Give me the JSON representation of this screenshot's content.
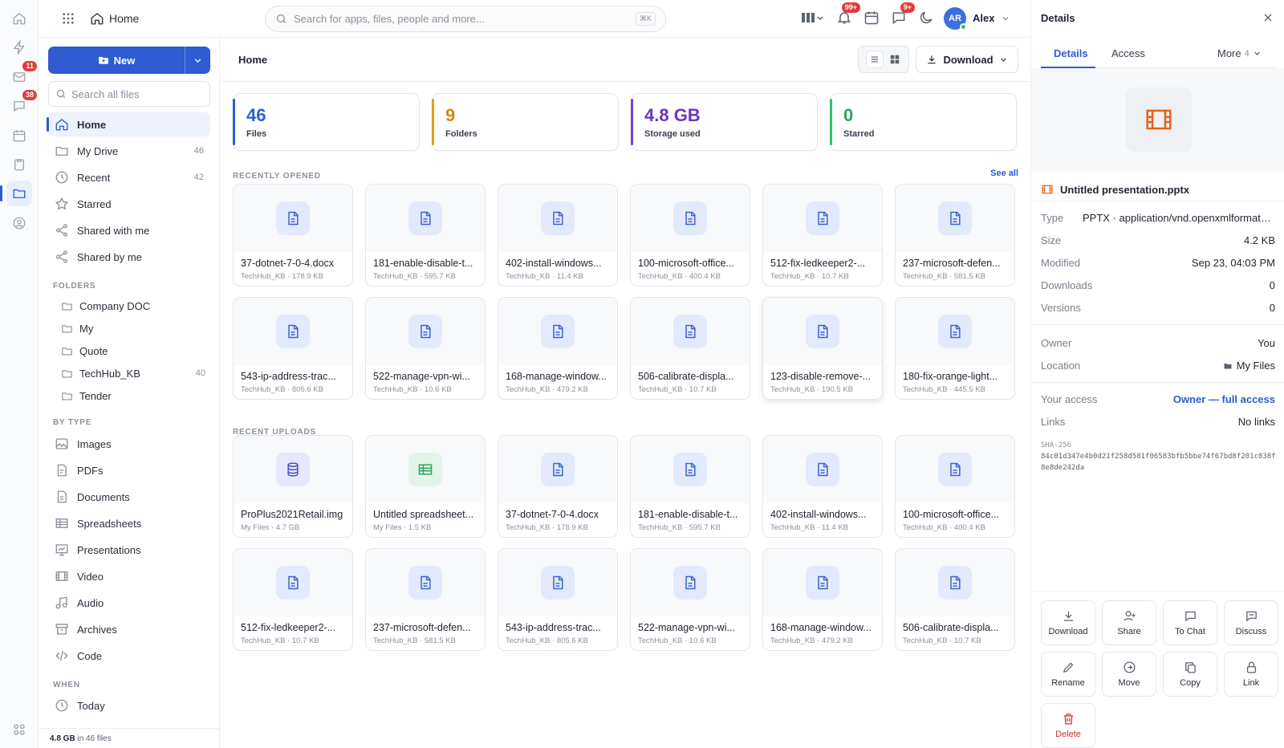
{
  "rail": {
    "mail_badge": "11",
    "chat_badge": "38"
  },
  "topbar": {
    "crumb": "Home",
    "search_placeholder": "Search for apps, files, people and more...",
    "search_kbd": "⌘K",
    "notif_badge": "99+",
    "alert_badge": "9+",
    "avatar_initials": "AR",
    "user_name": "Alex"
  },
  "sidebar": {
    "new_label": "New",
    "search_placeholder": "Search all files",
    "nav": [
      {
        "label": "Home",
        "count": ""
      },
      {
        "label": "My Drive",
        "count": "46"
      },
      {
        "label": "Recent",
        "count": "42"
      },
      {
        "label": "Starred",
        "count": ""
      },
      {
        "label": "Shared with me",
        "count": ""
      },
      {
        "label": "Shared by me",
        "count": ""
      }
    ],
    "folders_title": "FOLDERS",
    "folders": [
      {
        "label": "Company DOC",
        "count": ""
      },
      {
        "label": "My",
        "count": ""
      },
      {
        "label": "Quote",
        "count": ""
      },
      {
        "label": "TechHub_KB",
        "count": "40"
      },
      {
        "label": "Tender",
        "count": ""
      }
    ],
    "bytype_title": "BY TYPE",
    "types": [
      "Images",
      "PDFs",
      "Documents",
      "Spreadsheets",
      "Presentations",
      "Video",
      "Audio",
      "Archives",
      "Code"
    ],
    "when_title": "WHEN",
    "when": [
      "Today"
    ],
    "footer_size": "4.8 GB",
    "footer_rest": " in 46 files"
  },
  "main": {
    "title": "Home",
    "download_label": "Download",
    "stats": [
      {
        "value": "46",
        "label": "Files"
      },
      {
        "value": "9",
        "label": "Folders"
      },
      {
        "value": "4.8 GB",
        "label": "Storage used"
      },
      {
        "value": "0",
        "label": "Starred"
      }
    ],
    "recent_title": "RECENTLY OPENED",
    "see_all": "See all",
    "recent": [
      {
        "name": "37-dotnet-7-0-4.docx",
        "meta": "TechHub_KB · 178.9 KB"
      },
      {
        "name": "181-enable-disable-t...",
        "meta": "TechHub_KB · 595.7 KB"
      },
      {
        "name": "402-install-windows...",
        "meta": "TechHub_KB · 11.4 KB"
      },
      {
        "name": "100-microsoft-office...",
        "meta": "TechHub_KB · 400.4 KB"
      },
      {
        "name": "512-fix-ledkeeper2-...",
        "meta": "TechHub_KB · 10.7 KB"
      },
      {
        "name": "237-microsoft-defen...",
        "meta": "TechHub_KB · 581.5 KB"
      },
      {
        "name": "543-ip-address-trac...",
        "meta": "TechHub_KB · 805.6 KB"
      },
      {
        "name": "522-manage-vpn-wi...",
        "meta": "TechHub_KB · 10.6 KB"
      },
      {
        "name": "168-manage-window...",
        "meta": "TechHub_KB · 479.2 KB"
      },
      {
        "name": "506-calibrate-displa...",
        "meta": "TechHub_KB · 10.7 KB"
      },
      {
        "name": "123-disable-remove-...",
        "meta": "TechHub_KB · 190.5 KB"
      },
      {
        "name": "180-fix-orange-light...",
        "meta": "TechHub_KB · 445.5 KB"
      }
    ],
    "uploads_title": "RECENT UPLOADS",
    "uploads": [
      {
        "name": "ProPlus2021Retail.img",
        "meta": "My Files · 4.7 GB",
        "kind": "db"
      },
      {
        "name": "Untitled spreadsheet...",
        "meta": "My Files · 1.5 KB",
        "kind": "sheet"
      },
      {
        "name": "37-dotnet-7-0-4.docx",
        "meta": "TechHub_KB · 178.9 KB",
        "kind": "doc"
      },
      {
        "name": "181-enable-disable-t...",
        "meta": "TechHub_KB · 595.7 KB",
        "kind": "doc"
      },
      {
        "name": "402-install-windows...",
        "meta": "TechHub_KB · 11.4 KB",
        "kind": "doc"
      },
      {
        "name": "100-microsoft-office...",
        "meta": "TechHub_KB · 400.4 KB",
        "kind": "doc"
      },
      {
        "name": "512-fix-ledkeeper2-...",
        "meta": "TechHub_KB · 10.7 KB",
        "kind": "doc"
      },
      {
        "name": "237-microsoft-defen...",
        "meta": "TechHub_KB · 581.5 KB",
        "kind": "doc"
      },
      {
        "name": "543-ip-address-trac...",
        "meta": "TechHub_KB · 805.6 KB",
        "kind": "doc"
      },
      {
        "name": "522-manage-vpn-wi...",
        "meta": "TechHub_KB · 10.6 KB",
        "kind": "doc"
      },
      {
        "name": "168-manage-window...",
        "meta": "TechHub_KB · 479.2 KB",
        "kind": "doc"
      },
      {
        "name": "506-calibrate-displa...",
        "meta": "TechHub_KB · 10.7 KB",
        "kind": "doc"
      }
    ]
  },
  "details": {
    "title": "Details",
    "tab_details": "Details",
    "tab_access": "Access",
    "more": "More",
    "more_count": "4",
    "file_name": "Untitled presentation.pptx",
    "rows": [
      {
        "k": "Type",
        "v": "PPTX · application/vnd.openxmlformats-..."
      },
      {
        "k": "Size",
        "v": "4.2 KB"
      },
      {
        "k": "Modified",
        "v": "Sep 23, 04:03 PM"
      },
      {
        "k": "Downloads",
        "v": "0"
      },
      {
        "k": "Versions",
        "v": "0"
      },
      {
        "k": "Owner",
        "v": "You"
      },
      {
        "k": "Location",
        "v": "My Files"
      },
      {
        "k": "Your access",
        "v": "Owner — full access"
      },
      {
        "k": "Links",
        "v": "No links"
      }
    ],
    "sha_label": "SHA-256",
    "sha_value": "84c01d347e4b0d21f258d581f06583bfb5bbe74f67bd8f201c038f8e8de242da",
    "actions": [
      "Download",
      "Share",
      "To Chat",
      "Discuss",
      "Rename",
      "Move",
      "Copy",
      "Link",
      "Delete"
    ]
  }
}
